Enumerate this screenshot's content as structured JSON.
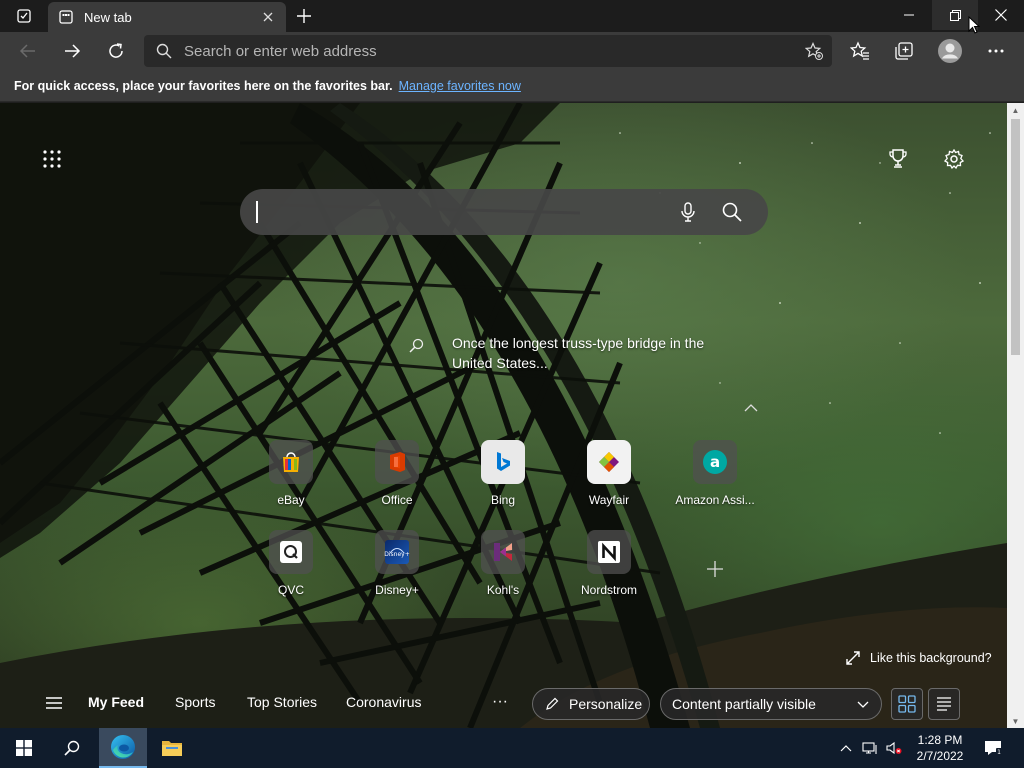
{
  "titlebar": {
    "tab_title": "New tab"
  },
  "toolbar": {
    "address_placeholder": "Search or enter web address"
  },
  "favorites_bar": {
    "message": "For quick access, place your favorites here on the favorites bar.",
    "link": "Manage favorites now"
  },
  "ntp": {
    "caption": "Once the longest truss-type bridge in the United States...",
    "tiles": [
      {
        "label": "eBay",
        "icon": "ebay-icon"
      },
      {
        "label": "Office",
        "icon": "office-icon"
      },
      {
        "label": "Bing",
        "icon": "bing-icon"
      },
      {
        "label": "Wayfair",
        "icon": "wayfair-icon"
      },
      {
        "label": "Amazon Assi...",
        "icon": "amazon-assistant-icon"
      },
      {
        "label": "QVC",
        "icon": "qvc-icon"
      },
      {
        "label": "Disney+",
        "icon": "disney-plus-icon"
      },
      {
        "label": "Kohl's",
        "icon": "kohls-icon"
      },
      {
        "label": "Nordstrom",
        "icon": "nordstrom-icon"
      }
    ],
    "like_background": "Like this background?"
  },
  "feed": {
    "tabs": [
      "My Feed",
      "Sports",
      "Top Stories",
      "Coronavirus"
    ],
    "more": "···",
    "personalize": "Personalize",
    "content_visibility": "Content partially visible"
  },
  "taskbar": {
    "time": "1:28 PM",
    "date": "2/7/2022"
  },
  "colors": {
    "accent": "#76b9ed",
    "link": "#6cb4ff",
    "toolbar": "#3b3b3b"
  }
}
